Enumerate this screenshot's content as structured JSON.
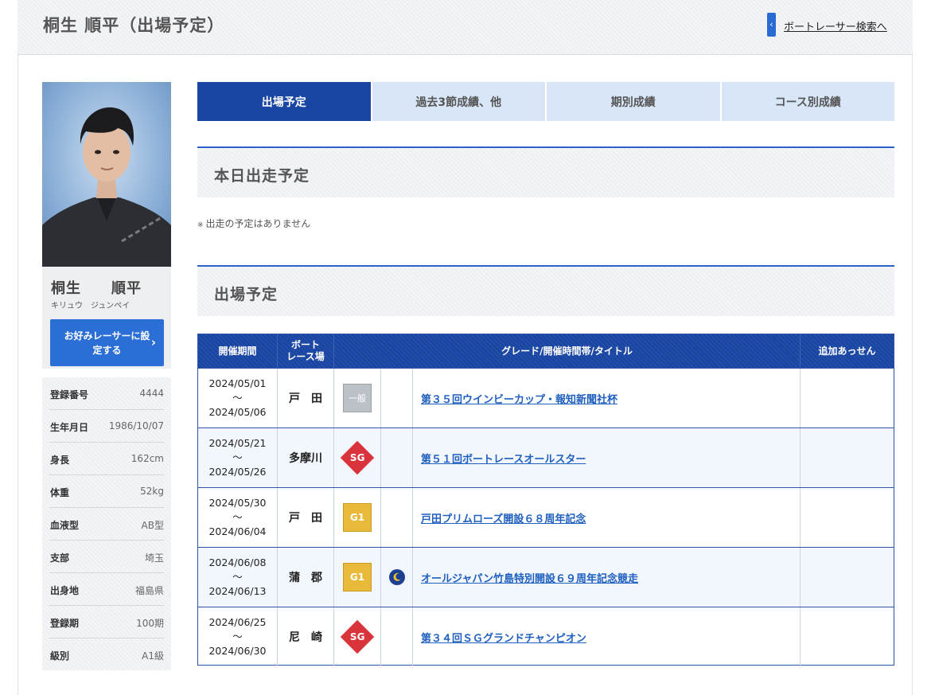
{
  "header": {
    "title": "桐生 順平（出場予定）",
    "back_chevron": "‹",
    "back_link": "ボートレーサー検索へ"
  },
  "racer": {
    "name": "桐生　　順平",
    "kana": "キリュウ　ジュンペイ",
    "favorite_button": "お好みレーサーに設定する",
    "favorite_chevron": "›"
  },
  "profile": [
    {
      "label": "登録番号",
      "value": "4444"
    },
    {
      "label": "生年月日",
      "value": "1986/10/07"
    },
    {
      "label": "身長",
      "value": "162cm"
    },
    {
      "label": "体重",
      "value": "52kg"
    },
    {
      "label": "血液型",
      "value": "AB型"
    },
    {
      "label": "支部",
      "value": "埼玉"
    },
    {
      "label": "出身地",
      "value": "福島県"
    },
    {
      "label": "登録期",
      "value": "100期"
    },
    {
      "label": "級別",
      "value": "A1級"
    }
  ],
  "tabs": [
    {
      "label": "出場予定"
    },
    {
      "label": "過去3節成績、他"
    },
    {
      "label": "期別成績"
    },
    {
      "label": "コース別成績"
    }
  ],
  "today": {
    "title": "本日出走予定",
    "mark": "※",
    "note": "出走の予定はありません"
  },
  "schedule": {
    "title": "出場予定",
    "columns": {
      "period": "開催期間",
      "stadium_1": "ボート",
      "stadium_2": "レース場",
      "title": "グレード/開催時間帯/タイトル",
      "add": "追加あっせん"
    },
    "rows": [
      {
        "start": "2024/05/01",
        "sep": "〜",
        "end": "2024/05/06",
        "stadium": "戸　田",
        "grade": "一般",
        "grade_type": "ippan",
        "time": "",
        "title": "第３５回ウインビーカップ・報知新聞社杯",
        "add": ""
      },
      {
        "start": "2024/05/21",
        "sep": "〜",
        "end": "2024/05/26",
        "stadium": "多摩川",
        "grade": "SG",
        "grade_type": "sg",
        "time": "",
        "title": "第５１回ボートレースオールスター",
        "add": ""
      },
      {
        "start": "2024/05/30",
        "sep": "〜",
        "end": "2024/06/04",
        "stadium": "戸　田",
        "grade": "G1",
        "grade_type": "g1",
        "time": "",
        "title": "戸田プリムローズ開設６８周年記念",
        "add": ""
      },
      {
        "start": "2024/06/08",
        "sep": "〜",
        "end": "2024/06/13",
        "stadium": "蒲　郡",
        "grade": "G1",
        "grade_type": "g1",
        "time": "moon-icon",
        "title": "オールジャパン竹島特別開設６９周年記念競走",
        "add": ""
      },
      {
        "start": "2024/06/25",
        "sep": "〜",
        "end": "2024/06/30",
        "stadium": "尼　崎",
        "grade": "SG",
        "grade_type": "sg",
        "time": "",
        "title": "第３４回ＳＧグランドチャンピオン",
        "add": ""
      }
    ]
  },
  "colors": {
    "brand_navy": "#1a46a3",
    "accent_blue": "#2b6fd6",
    "link_blue": "#1f5fbf",
    "sg_red": "#d9333b",
    "g1_gold": "#e9b93a",
    "ippan_gray": "#bcc1c7"
  }
}
